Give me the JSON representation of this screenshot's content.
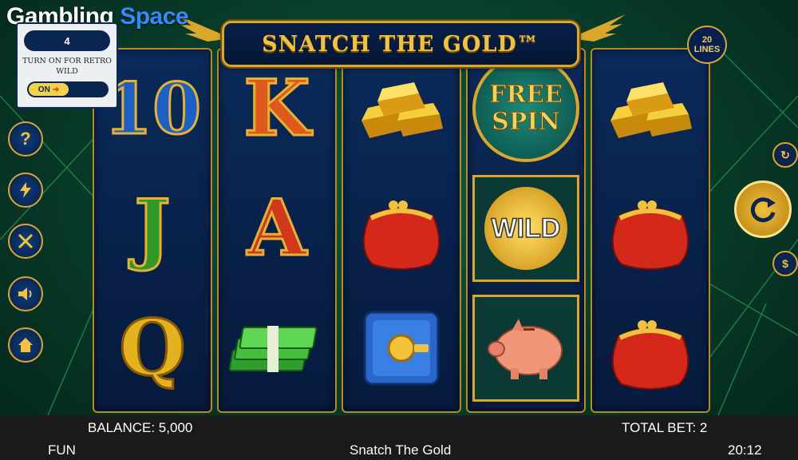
{
  "brand": {
    "part1": "Gambling",
    "part2": "Space"
  },
  "game_title": "SNATCH THE GOLD™",
  "lines_badge": {
    "count": "20",
    "label": "LINES"
  },
  "retro_panel": {
    "value": "4",
    "label": "Turn on for retro wild",
    "toggle": "ON"
  },
  "reels": [
    [
      "10",
      "J",
      "Q"
    ],
    [
      "K",
      "A",
      "cash-stack"
    ],
    [
      "gold-bars",
      "red-purse",
      "blue-safe"
    ],
    [
      "FREE SPIN",
      "WILD",
      "piggy-bank"
    ],
    [
      "gold-bars",
      "red-purse",
      "red-purse"
    ]
  ],
  "side_buttons": [
    "help-icon",
    "lightning-icon",
    "settings-tools-icon",
    "sound-icon",
    "home-icon"
  ],
  "footer": {
    "balance": "BALANCE: 5,000",
    "total_bet": "TOTAL BET: 2",
    "mode": "FUN",
    "game_name": "Snatch The Gold",
    "time": "20:12"
  },
  "colors": {
    "gold": "#d9a72a",
    "navy": "#061a3c",
    "felt": "#0d5a3c"
  }
}
